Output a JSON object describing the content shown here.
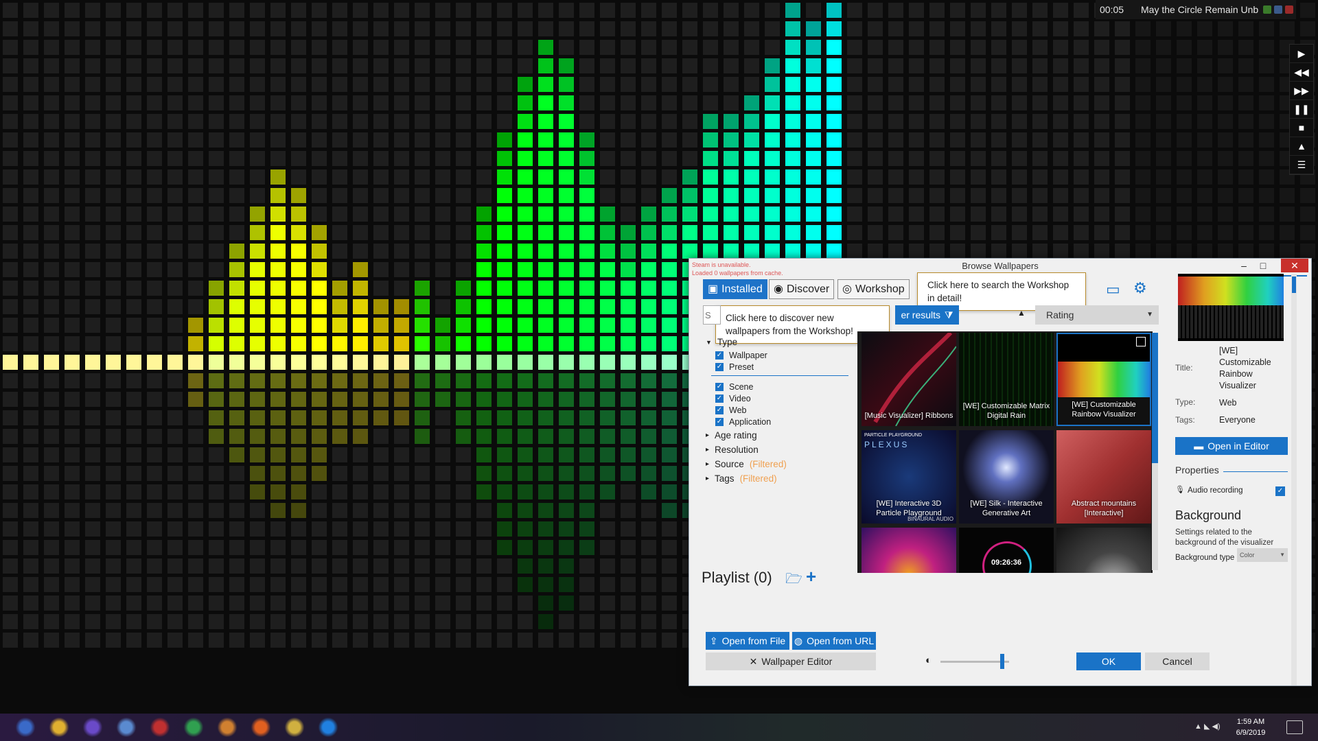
{
  "media_widget": {
    "time": "00:05",
    "title": "May the Circle Remain Unb",
    "controls": [
      {
        "name": "play-icon",
        "glyph": "▶"
      },
      {
        "name": "rewind-icon",
        "glyph": "◀◀"
      },
      {
        "name": "fast-forward-icon",
        "glyph": "▶▶"
      },
      {
        "name": "pause-icon",
        "glyph": "❚❚"
      },
      {
        "name": "stop-icon",
        "glyph": "■"
      },
      {
        "name": "eject-icon",
        "glyph": "▲"
      },
      {
        "name": "menu-icon",
        "glyph": "☰"
      }
    ]
  },
  "dialog": {
    "title": "Browse Wallpapers",
    "status_line1": "Steam is unavailable.",
    "status_line2": "Loaded 0 wallpapers from cache.",
    "tabs": {
      "installed": "Installed",
      "discover": "Discover",
      "workshop": "Workshop"
    },
    "tooltips": {
      "workshop": "Click here to search the Workshop in detail!",
      "discover": "Click here to discover new wallpapers from the Workshop!"
    },
    "filter_results_label": "er results",
    "sort_select": "Rating",
    "search_placeholder": "S",
    "filters": {
      "type_header": "Type",
      "checks_a": [
        "Wallpaper",
        "Preset"
      ],
      "checks_b": [
        "Scene",
        "Video",
        "Web",
        "Application"
      ],
      "tree": [
        {
          "label": "Age rating",
          "suffix": ""
        },
        {
          "label": "Resolution",
          "suffix": ""
        },
        {
          "label": "Source",
          "suffix": "(Filtered)"
        },
        {
          "label": "Tags",
          "suffix": "(Filtered)"
        }
      ]
    },
    "thumbnails": [
      {
        "label": "[Music Visualizer] Ribbons"
      },
      {
        "label": "[WE] Customizable Matrix Digital Rain"
      },
      {
        "label": "[WE] Customizable Rainbow Visualizer"
      },
      {
        "label": "[WE] Interactive 3D Particle Playground"
      },
      {
        "label": "[WE] Silk - Interactive Generative Art"
      },
      {
        "label": "Abstract mountains [Interactive]"
      },
      {
        "label": ""
      },
      {
        "label": "09:26:36"
      },
      {
        "label": ""
      }
    ],
    "thumb_overlay_text": {
      "plexus_top": "PARTICLE PLAYGROUND",
      "plexus_title": "PLEXUS",
      "plexus_bottom": "BINAURAL AUDIO"
    },
    "playlist_label": "Playlist (0)",
    "buttons": {
      "open_file": "Open from File",
      "open_url": "Open from URL",
      "wallpaper_editor": "Wallpaper Editor",
      "ok": "OK",
      "cancel": "Cancel",
      "open_in_editor": "Open in Editor"
    },
    "brightness_slider_fraction": 0.9,
    "details": {
      "title_label": "Title:",
      "title_value": "[WE] Customizable Rainbow Visualizer",
      "type_label": "Type:",
      "type_value": "Web",
      "tags_label": "Tags:",
      "tags_value": "Everyone",
      "properties_header": "Properties",
      "audio_recording": "Audio recording",
      "background_header": "Background",
      "background_desc": "Settings related to the background of the visualizer",
      "background_type_label": "Background type",
      "background_type_value": "Color"
    }
  },
  "taskbar": {
    "time": "1:59 AM",
    "date": "6/9/2019",
    "icons": [
      "start-icon",
      "file-explorer-icon",
      "app-purple-icon",
      "internet-explorer-icon",
      "calendar-app-icon",
      "chrome-icon",
      "folder-app-icon",
      "firefox-icon",
      "tools-icon",
      "wallpaper-engine-icon"
    ]
  },
  "colors": {
    "accent": "#1a73c7",
    "close": "#c8302b",
    "filtered": "#f0a050"
  }
}
